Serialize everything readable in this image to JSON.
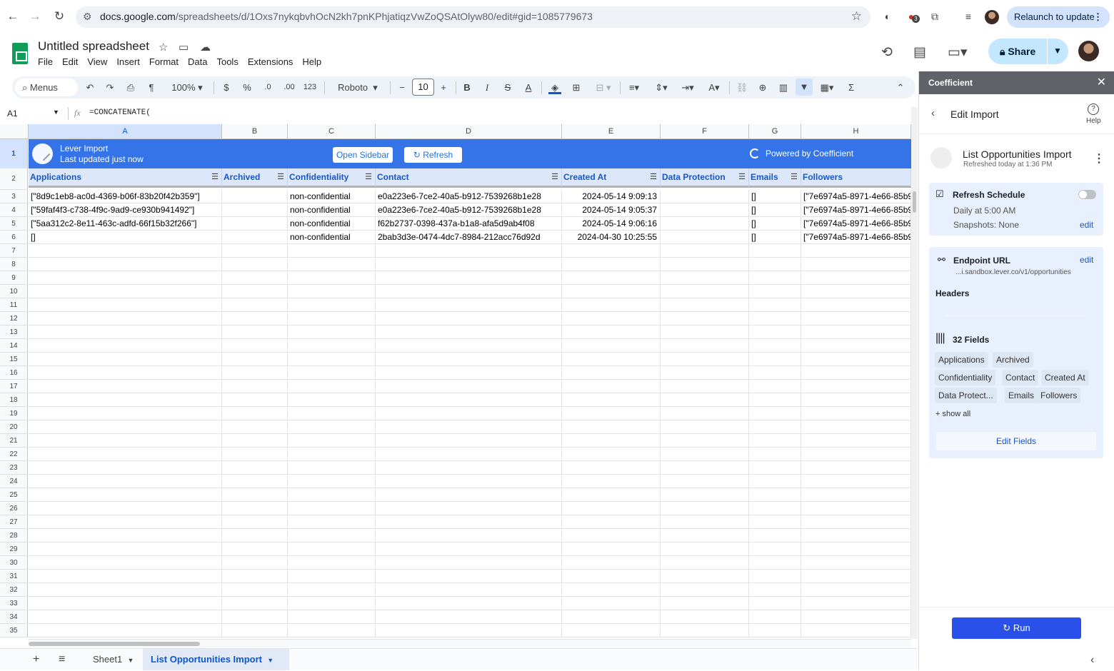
{
  "browser": {
    "url_domain": "docs.google.com",
    "url_path": "/spreadsheets/d/1Oxs7nykqbvhOcN2kh7pnKPhjatiqzVwZoQSAtOlyw80/edit#gid=1085779673",
    "relaunch_label": "Relaunch to update",
    "ext_badge": "3"
  },
  "doc": {
    "title": "Untitled spreadsheet",
    "menus": [
      "File",
      "Edit",
      "View",
      "Insert",
      "Format",
      "Data",
      "Tools",
      "Extensions",
      "Help"
    ],
    "share_label": "Share"
  },
  "toolbar": {
    "menus_label": "Menus",
    "zoom": "100%",
    "currency": "$",
    "percent": "%",
    "dec_decrease": ".0",
    "dec_increase": ".00",
    "number_format": "123",
    "font": "Roboto",
    "font_size": "10",
    "bold": "B",
    "italic": "I",
    "strike": "S",
    "text_color": "A"
  },
  "formula_bar": {
    "cell_ref": "A1",
    "fx": "fx",
    "formula": "=CONCATENATE("
  },
  "grid": {
    "columns": [
      {
        "letter": "A",
        "width": 271
      },
      {
        "letter": "B",
        "width": 92
      },
      {
        "letter": "C",
        "width": 123
      },
      {
        "letter": "D",
        "width": 261
      },
      {
        "letter": "E",
        "width": 138
      },
      {
        "letter": "F",
        "width": 124
      },
      {
        "letter": "G",
        "width": 73
      },
      {
        "letter": "H",
        "width": 154
      }
    ],
    "banner": {
      "title": "Lever Import",
      "subtitle": "Last updated just now",
      "open_sidebar": "Open Sidebar",
      "refresh": "Refresh",
      "powered_by": "Powered by Coefficient"
    },
    "headers": [
      "Applications",
      "Archived",
      "Confidentiality",
      "Contact",
      "Created At",
      "Data Protection",
      "Emails",
      "Followers"
    ],
    "rows": [
      [
        "[\"8d9c1eb8-ac0d-4369-b06f-83b20f42b359\"]",
        "",
        "non-confidential",
        "e0a223e6-7ce2-40a5-b912-7539268b1e28",
        "2024-05-14 9:09:13",
        "",
        "[]",
        "[\"7e6974a5-8971-4e66-85b9"
      ],
      [
        "[\"59faf4f3-c738-4f9c-9ad9-ce930b941492\"]",
        "",
        "non-confidential",
        "e0a223e6-7ce2-40a5-b912-7539268b1e28",
        "2024-05-14 9:05:37",
        "",
        "[]",
        "[\"7e6974a5-8971-4e66-85b9"
      ],
      [
        "[\"5aa312c2-8e11-463c-adfd-66f15b32f266\"]",
        "",
        "non-confidential",
        "f62b2737-0398-437a-b1a8-afa5d9ab4f08",
        "2024-05-14 9:06:16",
        "",
        "[]",
        "[\"7e6974a5-8971-4e66-85b9"
      ],
      [
        "[]",
        "",
        "non-confidential",
        "2bab3d3e-0474-4dc7-8984-212acc76d92d",
        "2024-04-30 10:25:55",
        "",
        "[]",
        "[\"7e6974a5-8971-4e66-85b9"
      ]
    ],
    "row_numbers": [
      "1",
      "2",
      "3",
      "4",
      "5",
      "6",
      "7",
      "8",
      "9",
      "10",
      "11",
      "12",
      "13",
      "14",
      "15",
      "16",
      "17",
      "18",
      "19",
      "20",
      "21",
      "22",
      "23",
      "24",
      "25",
      "26",
      "27",
      "28",
      "29",
      "30",
      "31",
      "32",
      "33",
      "34",
      "35"
    ]
  },
  "tabs": {
    "sheet1": "Sheet1",
    "active": "List Opportunities Import"
  },
  "sidepanel": {
    "title": "Coefficient",
    "nav_title": "Edit Import",
    "help": "Help",
    "import_name": "List Opportunities Import",
    "import_refreshed": "Refreshed today at 1:36 PM",
    "refresh_schedule": "Refresh Schedule",
    "schedule_time": "Daily at 5:00 AM",
    "snapshots": "Snapshots: None",
    "edit": "edit",
    "endpoint_label": "Endpoint URL",
    "endpoint_value": "...i.sandbox.lever.co/v1/opportunities",
    "headers_label": "Headers",
    "fields_count": "32 Fields",
    "fields": [
      "Applications",
      "Archived",
      "Confidentiality",
      "Contact",
      "Created At",
      "Data Protect...",
      "Emails",
      "Followers"
    ],
    "show_all": "+ show all",
    "edit_fields": "Edit Fields",
    "run": "Run"
  }
}
